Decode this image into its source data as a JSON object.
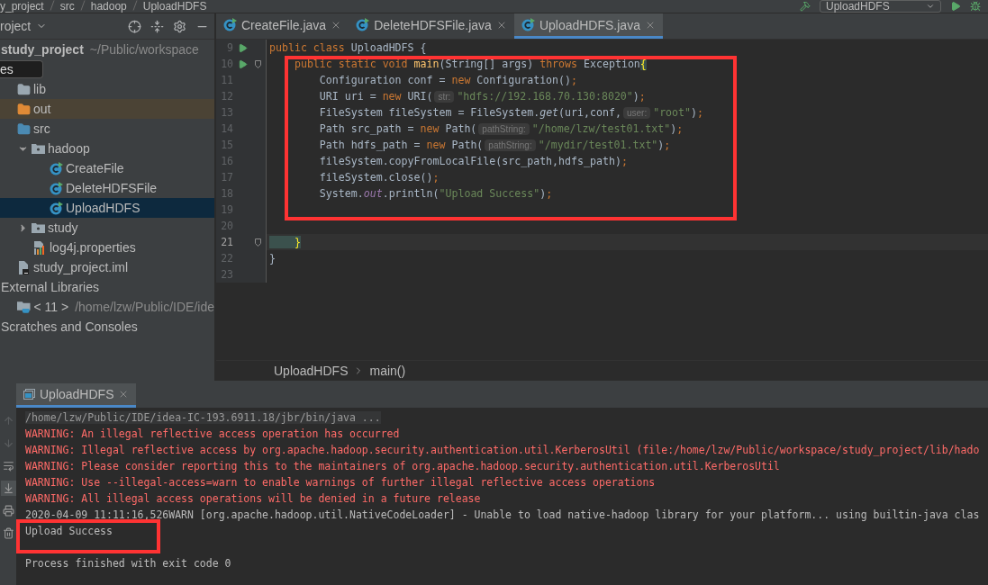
{
  "nav_bar": {
    "crumbs": [
      "y_project",
      "src",
      "hadoop",
      "UploadHDFS"
    ],
    "run_config": "UploadHDFS"
  },
  "project_panel": {
    "title": "roject",
    "tooltip": "es",
    "tree": [
      {
        "label": "study_project",
        "kind": "module",
        "description": "~/Public/workspace",
        "selected": false,
        "children": [
          {
            "label": "lib",
            "kind": "folder",
            "selected": false
          },
          {
            "label": "out",
            "kind": "excluded-folder",
            "selected": false
          },
          {
            "label": "src",
            "kind": "source-folder",
            "selected": false,
            "children": [
              {
                "label": "hadoop",
                "kind": "package",
                "expanded": true,
                "selected": false,
                "children": [
                  {
                    "label": "CreateFile",
                    "kind": "class",
                    "selected": false
                  },
                  {
                    "label": "DeleteHDFSFile",
                    "kind": "class",
                    "selected": false
                  },
                  {
                    "label": "UploadHDFS",
                    "kind": "class",
                    "selected": true
                  }
                ]
              },
              {
                "label": "study",
                "kind": "package",
                "expanded": false,
                "selected": false
              },
              {
                "label": "log4j.properties",
                "kind": "properties",
                "selected": false
              }
            ]
          },
          {
            "label": "study_project.iml",
            "kind": "module-file",
            "selected": false
          }
        ]
      },
      {
        "label": "External Libraries",
        "kind": "plain",
        "selected": false,
        "children": [
          {
            "label": "< 11 >",
            "kind": "library",
            "description": "/home/lzw/Public/IDE/ide",
            "selected": false
          }
        ]
      },
      {
        "label": "Scratches and Consoles",
        "kind": "plain",
        "selected": false
      }
    ]
  },
  "editor": {
    "tabs": [
      {
        "label": "CreateFile.java",
        "selected": false
      },
      {
        "label": "DeleteHDFSFile.java",
        "selected": false
      },
      {
        "label": "UploadHDFS.java",
        "selected": true
      }
    ],
    "lines": [
      {
        "number": "9",
        "run_marker": true,
        "fold": false,
        "current": false,
        "tokens": [
          {
            "kind": "keyword",
            "text": "public class "
          },
          {
            "kind": "plain",
            "text": "UploadHDFS {"
          }
        ]
      },
      {
        "number": "10",
        "run_marker": true,
        "fold": true,
        "current": false,
        "tokens": [
          {
            "kind": "keyword",
            "text": "    public static void "
          },
          {
            "kind": "method",
            "text": "main"
          },
          {
            "kind": "plain",
            "text": "(String[] args) "
          },
          {
            "kind": "keyword",
            "text": "throws "
          },
          {
            "kind": "plain",
            "text": "Exception"
          },
          {
            "kind": "brace",
            "text": "{"
          }
        ]
      },
      {
        "number": "11",
        "run_marker": false,
        "fold": false,
        "current": false,
        "tokens": [
          {
            "kind": "plain",
            "text": "        Configuration conf = "
          },
          {
            "kind": "keyword",
            "text": "new "
          },
          {
            "kind": "plain",
            "text": "Configuration()"
          },
          {
            "kind": "keyword",
            "text": ";"
          }
        ]
      },
      {
        "number": "12",
        "run_marker": false,
        "fold": false,
        "current": false,
        "tokens": [
          {
            "kind": "plain",
            "text": "        URI uri = "
          },
          {
            "kind": "keyword",
            "text": "new "
          },
          {
            "kind": "plain",
            "text": "URI("
          },
          {
            "kind": "hint",
            "text": "str:"
          },
          {
            "kind": "string",
            "text": "\"hdfs://192.168.70.130:8020\""
          },
          {
            "kind": "plain",
            "text": ")"
          },
          {
            "kind": "keyword",
            "text": ";"
          }
        ]
      },
      {
        "number": "13",
        "run_marker": false,
        "fold": false,
        "current": false,
        "tokens": [
          {
            "kind": "plain",
            "text": "        FileSystem fileSystem = FileSystem."
          },
          {
            "kind": "italic",
            "text": "get"
          },
          {
            "kind": "plain",
            "text": "(uri,conf,"
          },
          {
            "kind": "hint",
            "text": "user:"
          },
          {
            "kind": "string",
            "text": "\"root\""
          },
          {
            "kind": "plain",
            "text": ")"
          },
          {
            "kind": "keyword",
            "text": ";"
          }
        ]
      },
      {
        "number": "14",
        "run_marker": false,
        "fold": false,
        "current": false,
        "tokens": [
          {
            "kind": "plain",
            "text": "        Path src_path = "
          },
          {
            "kind": "keyword",
            "text": "new "
          },
          {
            "kind": "plain",
            "text": "Path("
          },
          {
            "kind": "hint",
            "text": "pathString:"
          },
          {
            "kind": "string",
            "text": "\"/home/lzw/test01.txt\""
          },
          {
            "kind": "plain",
            "text": ")"
          },
          {
            "kind": "keyword",
            "text": ";"
          }
        ]
      },
      {
        "number": "15",
        "run_marker": false,
        "fold": false,
        "current": false,
        "tokens": [
          {
            "kind": "plain",
            "text": "        Path hdfs_path = "
          },
          {
            "kind": "keyword",
            "text": "new "
          },
          {
            "kind": "plain",
            "text": "Path("
          },
          {
            "kind": "hint",
            "text": "pathString:"
          },
          {
            "kind": "string",
            "text": "\"/mydir/test01.txt\""
          },
          {
            "kind": "plain",
            "text": ")"
          },
          {
            "kind": "keyword",
            "text": ";"
          }
        ]
      },
      {
        "number": "16",
        "run_marker": false,
        "fold": false,
        "current": false,
        "tokens": [
          {
            "kind": "plain",
            "text": "        fileSystem.copyFromLocalFile(src_path,hdfs_path)"
          },
          {
            "kind": "keyword",
            "text": ";"
          }
        ]
      },
      {
        "number": "17",
        "run_marker": false,
        "fold": false,
        "current": false,
        "tokens": [
          {
            "kind": "plain",
            "text": "        fileSystem.close()"
          },
          {
            "kind": "keyword",
            "text": ";"
          }
        ]
      },
      {
        "number": "18",
        "run_marker": false,
        "fold": false,
        "current": false,
        "tokens": [
          {
            "kind": "plain",
            "text": "        System."
          },
          {
            "kind": "static",
            "text": "out"
          },
          {
            "kind": "plain",
            "text": ".println("
          },
          {
            "kind": "string",
            "text": "\"Upload Success\""
          },
          {
            "kind": "plain",
            "text": ")"
          },
          {
            "kind": "keyword",
            "text": ";"
          }
        ]
      },
      {
        "number": "19",
        "run_marker": false,
        "fold": false,
        "current": false
      },
      {
        "number": "20",
        "run_marker": false,
        "fold": false,
        "current": false
      },
      {
        "number": "21",
        "run_marker": false,
        "fold": true,
        "current": true,
        "tokens": [
          {
            "kind": "brace",
            "text": "    }"
          }
        ]
      },
      {
        "number": "22",
        "run_marker": false,
        "fold": false,
        "current": false,
        "tokens": [
          {
            "kind": "plain",
            "text": "}"
          }
        ]
      },
      {
        "number": "23",
        "run_marker": false,
        "fold": false,
        "current": false
      }
    ],
    "breadcrumbs": [
      "UploadHDFS",
      "main()"
    ]
  },
  "run_panel": {
    "tab": "UploadHDFS",
    "console": [
      {
        "kind": "command",
        "text": "/home/lzw/Public/IDE/idea-IC-193.6911.18/jbr/bin/java ..."
      },
      {
        "kind": "error",
        "text": "WARNING: An illegal reflective access operation has occurred"
      },
      {
        "kind": "error",
        "text": "WARNING: Illegal reflective access by org.apache.hadoop.security.authentication.util.KerberosUtil (file:/home/lzw/Public/workspace/study_project/lib/hado"
      },
      {
        "kind": "error",
        "text": "WARNING: Please consider reporting this to the maintainers of org.apache.hadoop.security.authentication.util.KerberosUtil"
      },
      {
        "kind": "error",
        "text": "WARNING: Use --illegal-access=warn to enable warnings of further illegal reflective access operations"
      },
      {
        "kind": "error",
        "text": "WARNING: All illegal access operations will be denied in a future release"
      },
      {
        "kind": "normal",
        "text": "2020-04-09 11:11:16,526WARN [org.apache.hadoop.util.NativeCodeLoader] - Unable to load native-hadoop library for your platform... using builtin-java clas"
      },
      {
        "kind": "normal",
        "text": "Upload Success"
      },
      {
        "kind": "blank"
      },
      {
        "kind": "normal",
        "text": "Process finished with exit code 0"
      }
    ]
  }
}
